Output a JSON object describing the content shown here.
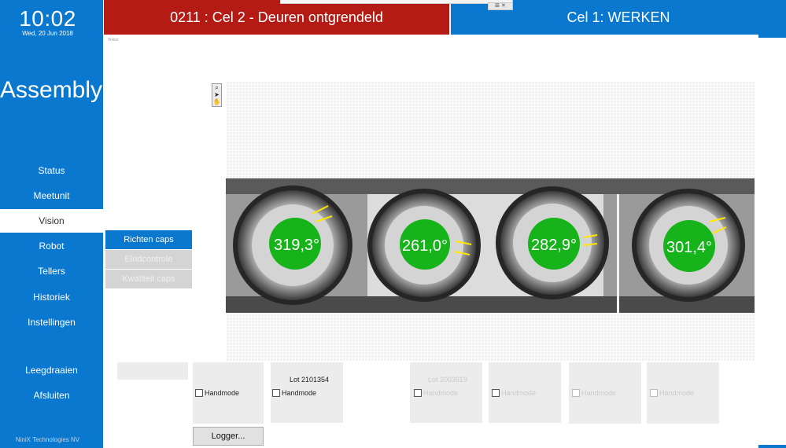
{
  "sidebar": {
    "time": "10:02",
    "date": "Wed, 20 Jun 2018",
    "app_title": "Assembly",
    "nav": [
      "Status",
      "Meetunit",
      "Vision",
      "Robot",
      "Tellers",
      "Historiek",
      "Instellingen"
    ],
    "active_nav": "Vision",
    "actions": [
      "Leegdraaien",
      "Afsluiten"
    ],
    "footer": "NiniX Technologies NV"
  },
  "header": {
    "alarm": "0211 : Cel 2 - Deuren ontgrendeld",
    "status": "Cel 1: WERKEN",
    "alarm_color": "#b31b14",
    "status_color": "#0a78cf"
  },
  "section_label": "Vision",
  "submenu": {
    "items": [
      "Richten caps",
      "Eindcontrole",
      "Kwaliteit caps"
    ],
    "active": "Richten caps"
  },
  "vision": {
    "angles": [
      "319,3°",
      "261,0°",
      "282,9°",
      "301,4°"
    ],
    "result_color": "#17b31b"
  },
  "panels": [
    {
      "lot": "",
      "check": "Handmode",
      "enabled": true
    },
    {
      "lot": "Lot 2101354",
      "check": "Handmode",
      "enabled": true
    },
    {
      "lot": "Lot 2003919",
      "check": "Handmode",
      "enabled": false
    },
    {
      "lot": "",
      "check": "Handmode",
      "enabled": false
    },
    {
      "lot": "",
      "check": "Handmode",
      "enabled": false
    },
    {
      "lot": "",
      "check": "Handmode",
      "enabled": false
    }
  ],
  "logger_button": "Logger...",
  "popup_icons": "⊞ ✕"
}
